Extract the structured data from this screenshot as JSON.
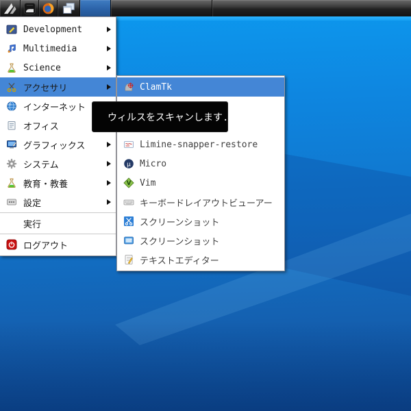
{
  "taskbar": {
    "buttons": [
      {
        "icon": "antix-logo-icon",
        "label": ""
      },
      {
        "icon": "file-manager-icon",
        "label": ""
      },
      {
        "icon": "firefox-icon",
        "label": ""
      },
      {
        "icon": "window-list-icon",
        "label": ""
      },
      {
        "icon": "active-task-button",
        "label": ""
      }
    ]
  },
  "menu": {
    "items": [
      {
        "label": "Development",
        "icon": "development-icon",
        "has_submenu": true
      },
      {
        "label": "Multimedia",
        "icon": "multimedia-icon",
        "has_submenu": true
      },
      {
        "label": "Science",
        "icon": "science-icon",
        "has_submenu": true
      },
      {
        "label": "アクセサリ",
        "icon": "accessories-icon",
        "has_submenu": true,
        "state": "highlighted"
      },
      {
        "label": "インターネット",
        "icon": "internet-icon",
        "has_submenu": true
      },
      {
        "label": "オフィス",
        "icon": "office-icon",
        "has_submenu": true
      },
      {
        "label": "グラフィックス",
        "icon": "graphics-icon",
        "has_submenu": true
      },
      {
        "label": "システム",
        "icon": "system-icon",
        "has_submenu": true
      },
      {
        "label": "教育・教養",
        "icon": "education-icon",
        "has_submenu": true
      },
      {
        "label": "設定",
        "icon": "settings-icon",
        "has_submenu": true
      },
      {
        "label": "実行",
        "icon": "",
        "has_submenu": false
      },
      {
        "label": "ログアウト",
        "icon": "logout-icon",
        "has_submenu": false
      }
    ]
  },
  "submenu": {
    "items": [
      {
        "label": "ClamTk",
        "icon": "clamtk-icon",
        "state": "highlighted"
      },
      {
        "label": "",
        "icon": "",
        "state": "obscured-by-tooltip"
      },
      {
        "label": "",
        "icon": "",
        "state": "obscured-by-tooltip"
      },
      {
        "label": "Limine-snapper-restore",
        "icon": "limine-snapper-icon"
      },
      {
        "label": "Micro",
        "icon": "micro-icon"
      },
      {
        "label": "Vim",
        "icon": "vim-icon"
      },
      {
        "label": "キーボードレイアウトビューアー",
        "icon": "keyboard-icon"
      },
      {
        "label": "スクリーンショット",
        "icon": "screenshot-scissors-icon"
      },
      {
        "label": "スクリーンショット",
        "icon": "screenshot-camera-icon"
      },
      {
        "label": "テキストエディター",
        "icon": "text-editor-icon"
      }
    ]
  },
  "tooltip": {
    "text": "ウィルスをスキャンします.."
  },
  "colors": {
    "highlight": "#4486d6",
    "menu_bg": "#ffffff",
    "tooltip_bg": "#040404",
    "taskbar_active": "#2a61a6",
    "wallpaper_top": "#12a2f4",
    "wallpaper_bottom": "#0d4f9c"
  }
}
